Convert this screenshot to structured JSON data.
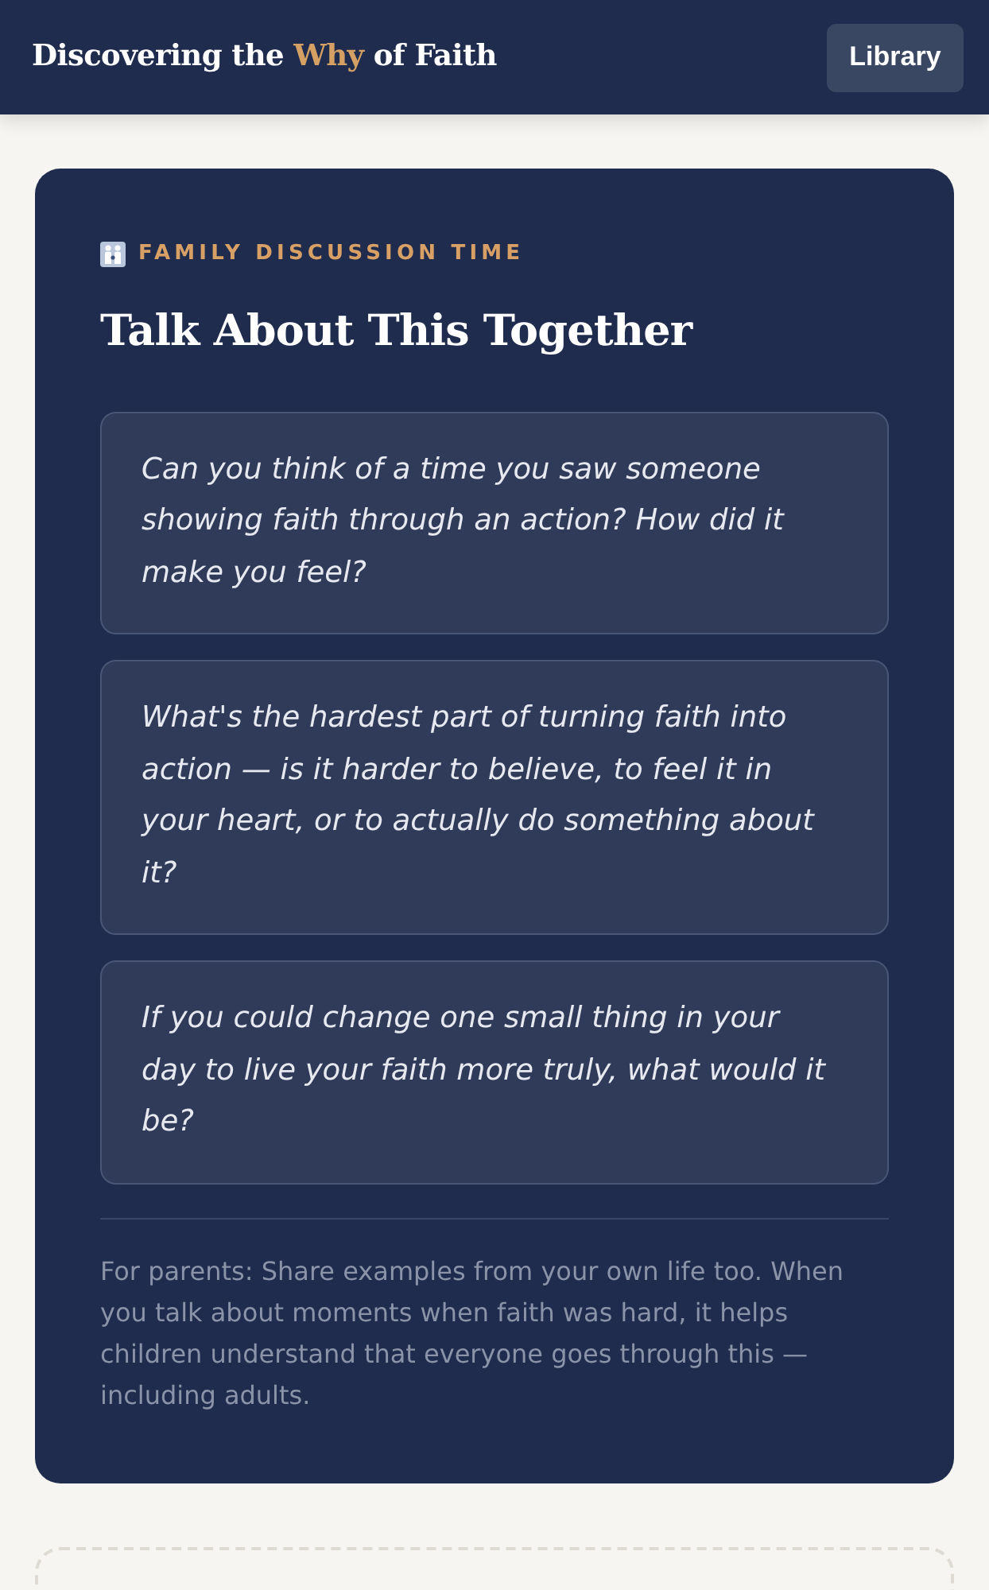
{
  "header": {
    "title": [
      {
        "text": "Discovering the",
        "highlighted": false
      },
      {
        "text": "Why",
        "highlighted": true
      },
      {
        "text": "of Faith",
        "highlighted": false
      }
    ],
    "button": "Library"
  },
  "discussion": {
    "eyebrow": "FAMILY DISCUSSION TIME",
    "heading": "Talk About This Together",
    "questions": [
      "Can you think of a time you saw someone showing faith through an action? How did it make you feel?",
      "What's the hardest part of turning faith into action — is it harder to believe, to feel it in your heart, or to actually do something about it?",
      "If you could change one small thing in your day to live your faith more truly, what would it be?"
    ],
    "note": "For parents: Share examples from your own life too. When you talk about moments when faith was hard, it helps children understand that everyone goes through this — including adults."
  }
}
